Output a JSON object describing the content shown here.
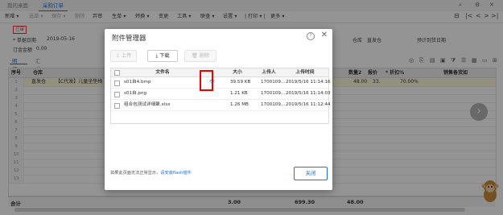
{
  "tabs": [
    {
      "label": "我的桌面",
      "active": false
    },
    {
      "label": "采购订单",
      "active": true
    }
  ],
  "window_icons": [
    "search-icon",
    "gear-icon",
    "close-icon"
  ],
  "toolbar": {
    "items": [
      {
        "label": "新增 ▾",
        "enabled": true
      },
      {
        "label": "选单 ▾",
        "enabled": false
      },
      {
        "label": "保存 ▾",
        "enabled": false
      },
      {
        "label": "删除",
        "enabled": false
      },
      {
        "label": "弃审",
        "enabled": true
      },
      {
        "label": "生单 ▾",
        "enabled": true
      },
      {
        "label": "转换 ▾",
        "enabled": true
      },
      {
        "label": "变更",
        "enabled": true
      },
      {
        "label": "工具 ▾",
        "enabled": true
      },
      {
        "label": "联查 ▾",
        "enabled": true
      },
      {
        "label": "设置 ▾",
        "enabled": true
      },
      {
        "label": "| 打印 ▾ |",
        "enabled": true
      },
      {
        "label": "更多 ▾",
        "enabled": true
      }
    ],
    "nav": [
      "⊟",
      "|<",
      "<",
      ">",
      ">|"
    ]
  },
  "form": {
    "status": "已审",
    "date_label": "* 单据日期",
    "date_value": "2019-05-16",
    "amount_label": "订金金额",
    "amount_value": "0.00",
    "warehouse_label": "仓库",
    "warehouse_value": "直发仓",
    "arrival_label": "预计到货日期"
  },
  "subtabs": [
    {
      "label": "明细",
      "active": true
    },
    {
      "label": "汇总",
      "active": false
    }
  ],
  "grid": {
    "headers": [
      "序号",
      "仓库",
      "数量2",
      "报价",
      "* 折扣%",
      "销售备货如"
    ],
    "rows": [
      {
        "no": "1",
        "warehouse": "直发仓",
        "product": "【C代发】儿童坐垫椅",
        "qty2": "48.00",
        "price": "33.",
        "discount": "70.00%",
        "selected": true
      },
      {
        "no": "2"
      },
      {
        "no": "3"
      },
      {
        "no": "4"
      },
      {
        "no": "5"
      },
      {
        "no": "6"
      },
      {
        "no": "7"
      },
      {
        "no": "8"
      },
      {
        "no": "9"
      },
      {
        "no": "10"
      },
      {
        "no": "11"
      },
      {
        "no": "12"
      },
      {
        "no": "13"
      }
    ]
  },
  "footer": {
    "label": "合计",
    "qty": "3.00",
    "amount": "699.30",
    "qty2": "48.00"
  },
  "dialog": {
    "title": "附件管理器",
    "buttons": {
      "upload": "上传",
      "download": "下载",
      "delete": "删除"
    },
    "headers": [
      "文件名",
      "大小",
      "上传人",
      "上传时间"
    ],
    "files": [
      {
        "name": "s01自4.bmp",
        "size": "39.59 KB",
        "uploader": "1700109...",
        "time": "2019/5/16 11:14:16",
        "selected": true
      },
      {
        "name": "s01自.png",
        "size": "1.21 KB",
        "uploader": "1700109...",
        "time": "2019/5/16 11:14:03",
        "selected": false
      },
      {
        "name": "组合包测试详细聚.xlsx",
        "size": "1.26 MB",
        "uploader": "1700109...",
        "time": "2019/5/16 11:12:44",
        "selected": false
      }
    ],
    "hint": "如果此页面无法正常显示，",
    "hint_link": "请安装flash插件",
    "close_label": "关闭"
  }
}
